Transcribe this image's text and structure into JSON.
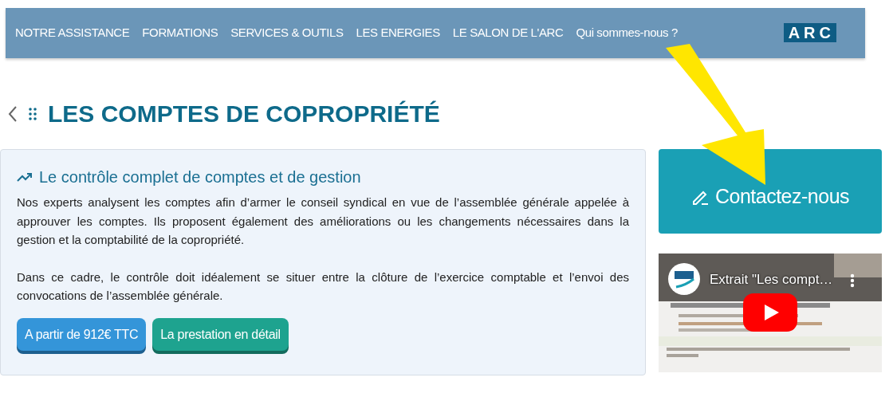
{
  "nav": {
    "items": [
      {
        "label": "NOTRE ASSISTANCE"
      },
      {
        "label": "FORMATIONS"
      },
      {
        "label": "SERVICES & OUTILS"
      },
      {
        "label": "LES ENERGIES"
      },
      {
        "label": "LE SALON DE L'ARC"
      },
      {
        "label": "Qui sommes-nous ?"
      }
    ],
    "logo": "ARC"
  },
  "page": {
    "title": "LES COMPTES DE COPROPRIÉTÉ"
  },
  "card": {
    "title": "Le contrôle complet de comptes et de gestion",
    "paragraphs": [
      "Nos experts analysent les comptes afin d’armer le conseil syndical en vue de l’assemblée générale appelée à approuver les comptes. Ils proposent également des améliorations ou les changements nécessaires dans la gestion et la comptabilité de la copropriété.",
      "Dans ce cadre, le contrôle doit idéalement se situer entre la clôture de l’exercice comptable et l’envoi des convocations de l’assemblée générale."
    ],
    "buttons": [
      {
        "label": "A partir de 912€ TTC",
        "kind": "price"
      },
      {
        "label": "La prestation en détail",
        "kind": "detail"
      }
    ]
  },
  "contact": {
    "label": "Contactez-nous"
  },
  "video": {
    "kind": "picture",
    "title": "Extrait \"Les compt…"
  }
}
